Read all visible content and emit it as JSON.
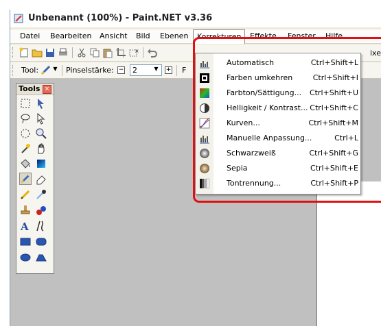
{
  "window": {
    "title": "Unbenannt (100%) - Paint.NET v3.36"
  },
  "menubar": {
    "items": [
      {
        "label": "Datei"
      },
      {
        "label": "Bearbeiten"
      },
      {
        "label": "Ansicht"
      },
      {
        "label": "Bild"
      },
      {
        "label": "Ebenen"
      },
      {
        "label": "Korrekturen",
        "active": true
      },
      {
        "label": "Effekte"
      },
      {
        "label": "Fenster"
      },
      {
        "label": "Hilfe"
      }
    ]
  },
  "toolbar1": {
    "icons": [
      "new-document-icon",
      "open-folder-icon",
      "save-icon",
      "print-icon",
      "cut-icon",
      "copy-icon",
      "paste-icon",
      "crop-icon",
      "deselect-icon",
      "undo-icon"
    ],
    "right_fragment": "ixe"
  },
  "toolbar2": {
    "tool_label": "Tool:",
    "brush_width_label": "Pinselstärke:",
    "brush_width_value": "2",
    "minus": "−",
    "plus": "+",
    "fill_fragment": "F"
  },
  "tools_panel": {
    "title": "Tools",
    "close": "×",
    "tools": [
      "rectangle-select-icon",
      "move-selection-icon",
      "lasso-select-icon",
      "move-selection-outline-icon",
      "ellipse-select-icon",
      "zoom-icon",
      "magic-wand-icon",
      "pan-hand-icon",
      "paint-bucket-icon",
      "gradient-icon",
      "paintbrush-icon",
      "eraser-icon",
      "pencil-icon",
      "color-picker-icon",
      "clone-stamp-icon",
      "recolor-icon",
      "text-icon",
      "line-curve-icon",
      "rectangle-shape-icon",
      "rounded-rectangle-icon",
      "ellipse-shape-icon",
      "freeform-shape-icon"
    ],
    "selected_tool": "paintbrush-icon"
  },
  "dropdown": {
    "items": [
      {
        "label": "Automatisch",
        "shortcut": "Ctrl+Shift+L",
        "icon": "levels-auto-icon"
      },
      {
        "label": "Farben umkehren",
        "shortcut": "Ctrl+Shift+I",
        "icon": "invert-colors-icon"
      },
      {
        "label": "Farbton/Sättigung...",
        "shortcut": "Ctrl+Shift+U",
        "icon": "hue-saturation-icon"
      },
      {
        "label": "Helligkeit / Kontrast...",
        "shortcut": "Ctrl+Shift+C",
        "icon": "brightness-contrast-icon"
      },
      {
        "label": "Kurven...",
        "shortcut": "Ctrl+Shift+M",
        "icon": "curves-icon"
      },
      {
        "label": "Manuelle Anpassung...",
        "shortcut": "Ctrl+L",
        "icon": "levels-icon"
      },
      {
        "label": "Schwarzweiß",
        "shortcut": "Ctrl+Shift+G",
        "icon": "black-white-icon"
      },
      {
        "label": "Sepia",
        "shortcut": "Ctrl+Shift+E",
        "icon": "sepia-icon"
      },
      {
        "label": "Tontrennung...",
        "shortcut": "Ctrl+Shift+P",
        "icon": "posterize-icon"
      }
    ]
  },
  "colors": {
    "highlight": "#e01010",
    "workspace": "#c0c0c0",
    "menu_bg": "#ffffff"
  }
}
